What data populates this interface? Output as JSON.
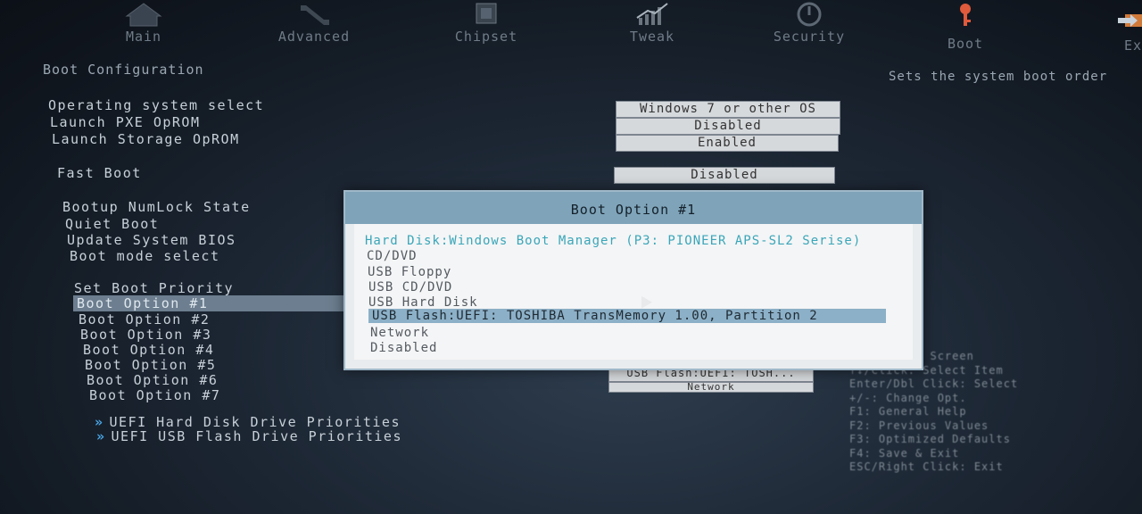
{
  "tabs": [
    {
      "label": "Main",
      "icon": "home-icon"
    },
    {
      "label": "Advanced",
      "icon": "wrench-icon"
    },
    {
      "label": "Chipset",
      "icon": "chip-icon"
    },
    {
      "label": "Tweak",
      "icon": "chart-icon"
    },
    {
      "label": "Security",
      "icon": "power-icon"
    },
    {
      "label": "Boot",
      "icon": "key-icon"
    },
    {
      "label": "Exit",
      "icon": "exit-icon"
    }
  ],
  "section_title": "Boot Configuration",
  "help_text": "Sets the system boot order",
  "settings": {
    "os_select": {
      "label": "Operating system select",
      "value": "Windows 7 or other OS"
    },
    "launch_pxe": {
      "label": "Launch PXE OpROM",
      "value": "Disabled"
    },
    "launch_storage": {
      "label": "Launch Storage OpROM",
      "value": "Enabled"
    },
    "fast_boot": {
      "label": "Fast Boot",
      "value": "Disabled"
    },
    "numlock": {
      "label": "Bootup NumLock State"
    },
    "quiet_boot": {
      "label": "Quiet Boot"
    },
    "update_bios": {
      "label": "Update System BIOS"
    },
    "boot_mode": {
      "label": "Boot mode select"
    }
  },
  "boot_priority": {
    "heading": "Set Boot Priority",
    "options": [
      "Boot Option #1",
      "Boot Option #2",
      "Boot Option #3",
      "Boot Option #4",
      "Boot Option #5",
      "Boot Option #6",
      "Boot Option #7"
    ],
    "partial_values": [
      "USB Flash:UEFI: TOSH...",
      "Network"
    ]
  },
  "submenus": [
    "UEFI Hard Disk Drive Priorities",
    "UEFI USB Flash Drive Priorities"
  ],
  "popup": {
    "title": "Boot Option #1",
    "options": [
      "Hard Disk:Windows Boot Manager (P3: PIONEER APS-SL2 Serise)",
      "CD/DVD",
      "USB Floppy",
      "USB CD/DVD",
      "USB Hard Disk",
      "USB Flash:UEFI: TOSHIBA TransMemory 1.00, Partition 2",
      "Network",
      "Disabled"
    ],
    "highlighted_index": 5
  },
  "key_help": [
    "→←: Select Screen",
    "↑↓/Click: Select Item",
    "Enter/Dbl Click: Select",
    "+/-: Change Opt.",
    "F1: General Help",
    "F2: Previous Values",
    "F3: Optimized Defaults",
    "F4: Save & Exit",
    "ESC/Right Click: Exit"
  ],
  "colors": {
    "highlight": "#8cb0c7",
    "popup_header": "#7fa4b9",
    "accent": "#4aa8e8"
  }
}
